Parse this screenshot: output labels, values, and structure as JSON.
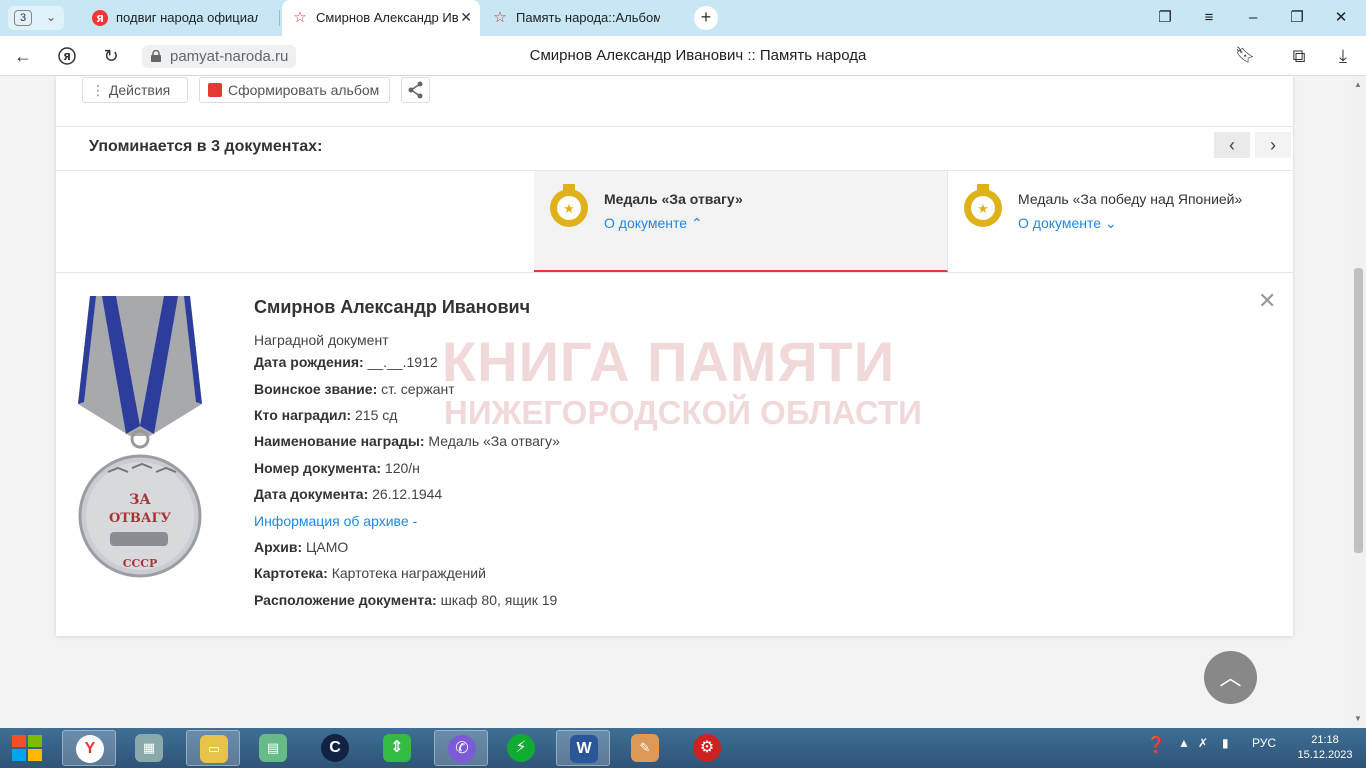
{
  "browser": {
    "tab_count": "3",
    "tabs": [
      {
        "title": "подвиг народа официальный",
        "icon": "yandex-icon"
      },
      {
        "title": "Смирнов Александр Иванович",
        "icon": "red-star-icon"
      },
      {
        "title": "Память народа::Альбом участника",
        "icon": "red-star-icon"
      }
    ],
    "url": "pamyat-naroda.ru",
    "page_title": "Смирнов Александр Иванович :: Память народа"
  },
  "toolbar": {
    "actions_label": "Действия",
    "album_label": "Сформировать альбом"
  },
  "documents": {
    "heading": "Упоминается в 3 документах:",
    "items": [
      {
        "title": "Медаль «За отвагу»",
        "link": "О документе",
        "selected": true
      },
      {
        "title": "Медаль «За победу над Японией»",
        "link": "О документе",
        "selected": false
      }
    ]
  },
  "person": {
    "name": "Смирнов Александр Иванович",
    "doc_type": "Наградной документ",
    "fields": [
      {
        "label": "Дата рождения:",
        "value": "__.__.1912"
      },
      {
        "label": "Воинское звание:",
        "value": "ст. сержант"
      },
      {
        "label": "Кто наградил:",
        "value": "215 сд"
      },
      {
        "label": "Наименование награды:",
        "value": "Медаль «За отвагу»"
      },
      {
        "label": "Номер документа:",
        "value": "120/н"
      },
      {
        "label": "Дата документа:",
        "value": "26.12.1944"
      }
    ],
    "archive_info_link": "Информация об архиве -",
    "archive_fields": [
      {
        "label": "Архив:",
        "value": "ЦАМО"
      },
      {
        "label": "Картотека:",
        "value": "Картотека награждений"
      },
      {
        "label": "Расположение документа:",
        "value": "шкаф 80, ящик 19"
      }
    ]
  },
  "medal_image": {
    "line1": "ЗА",
    "line2": "ОТВАГУ",
    "line3": "СССР"
  },
  "watermark": {
    "line1": "КНИГА ПАМЯТИ",
    "line2": "НИЖЕГОРОДСКОЙ ОБЛАСТИ"
  },
  "taskbar": {
    "lang": "РУС",
    "time": "21:18",
    "date": "15.12.2023"
  },
  "colors": {
    "accent_red": "#e53935",
    "link_blue": "#1e88e5",
    "medal_gold": "#e0b21a"
  }
}
